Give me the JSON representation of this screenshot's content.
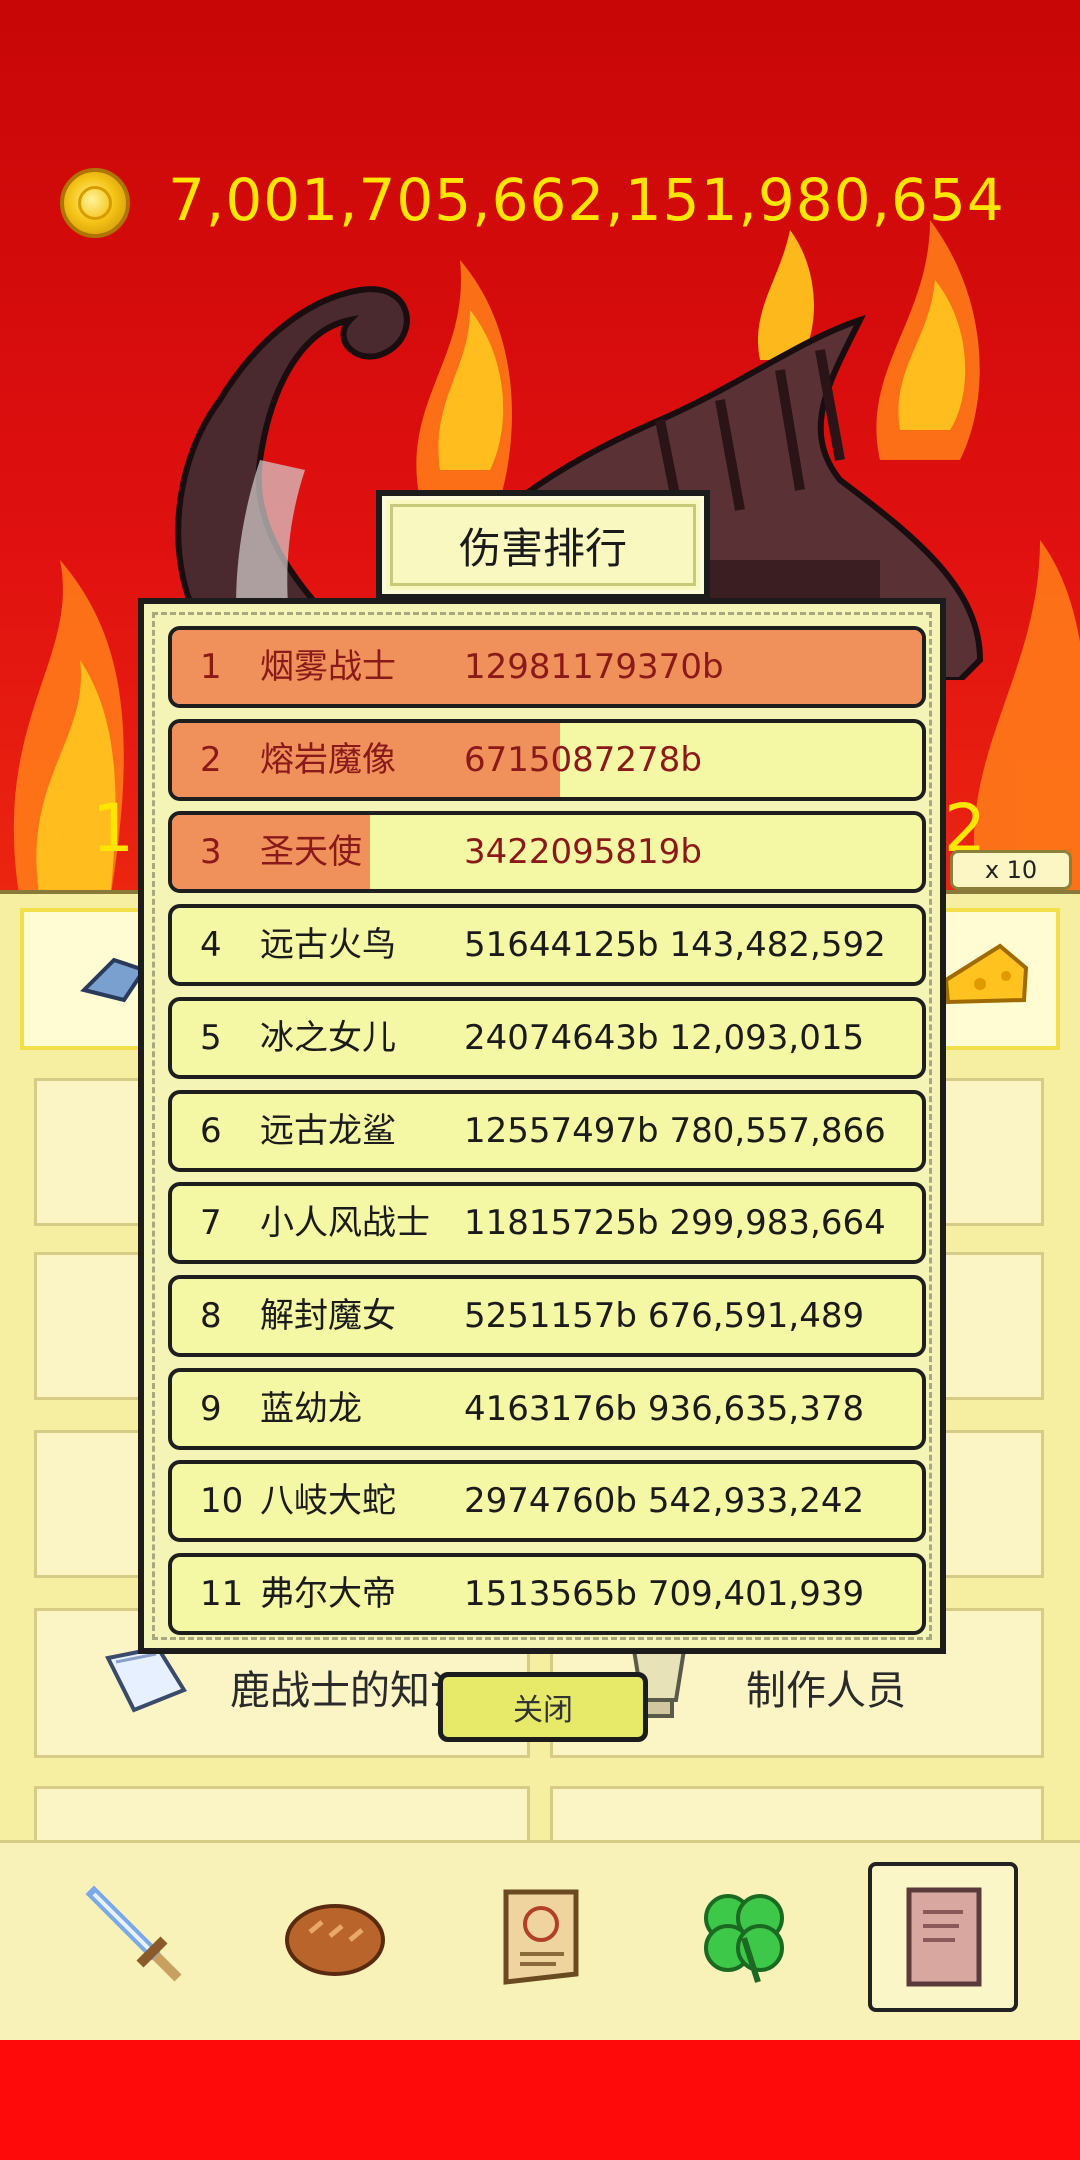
{
  "header": {
    "gold_amount": "7,001,705,662,151,980,654",
    "coin_icon": "gold-coin-icon"
  },
  "background": {
    "left_number_partial": "1,",
    "right_number_partial": "2",
    "multiplier_label": "x 10",
    "under_card_labels": [
      "鹿战士的知识",
      "制作人员"
    ]
  },
  "leaderboard": {
    "title": "伤害排行",
    "close_label": "关闭",
    "rows": [
      {
        "rank": "1",
        "name": "烟雾战士",
        "damage": "12981179370b",
        "bar": 1.0
      },
      {
        "rank": "2",
        "name": "熔岩魔像",
        "damage": "6715087278b",
        "bar": 0.517
      },
      {
        "rank": "3",
        "name": "圣天使",
        "damage": "3422095819b",
        "bar": 0.264
      },
      {
        "rank": "4",
        "name": "远古火鸟",
        "damage": "51644125b 143,482,592",
        "bar": 0
      },
      {
        "rank": "5",
        "name": "冰之女儿",
        "damage": "24074643b 12,093,015",
        "bar": 0
      },
      {
        "rank": "6",
        "name": "远古龙鲨",
        "damage": "12557497b 780,557,866",
        "bar": 0
      },
      {
        "rank": "7",
        "name": "小人风战士",
        "damage": "11815725b 299,983,664",
        "bar": 0
      },
      {
        "rank": "8",
        "name": "解封魔女",
        "damage": "5251157b 676,591,489",
        "bar": 0
      },
      {
        "rank": "9",
        "name": "蓝幼龙",
        "damage": "4163176b 936,635,378",
        "bar": 0
      },
      {
        "rank": "10",
        "name": "八岐大蛇",
        "damage": "2974760b 542,933,242",
        "bar": 0
      },
      {
        "rank": "11",
        "name": "弗尔大帝",
        "damage": "1513565b 709,401,939",
        "bar": 0
      }
    ]
  },
  "bottom_nav": {
    "items": [
      {
        "icon": "sword-icon",
        "active": false
      },
      {
        "icon": "bread-icon",
        "active": false
      },
      {
        "icon": "scroll-icon",
        "active": false
      },
      {
        "icon": "clover-icon",
        "active": false
      },
      {
        "icon": "book-icon",
        "active": true
      }
    ]
  },
  "colors": {
    "gold_text": "#ffe600",
    "row_bg": "#f4f7a4",
    "row_fill": "#f0905a",
    "modal_bg": "#f4f4b6"
  }
}
